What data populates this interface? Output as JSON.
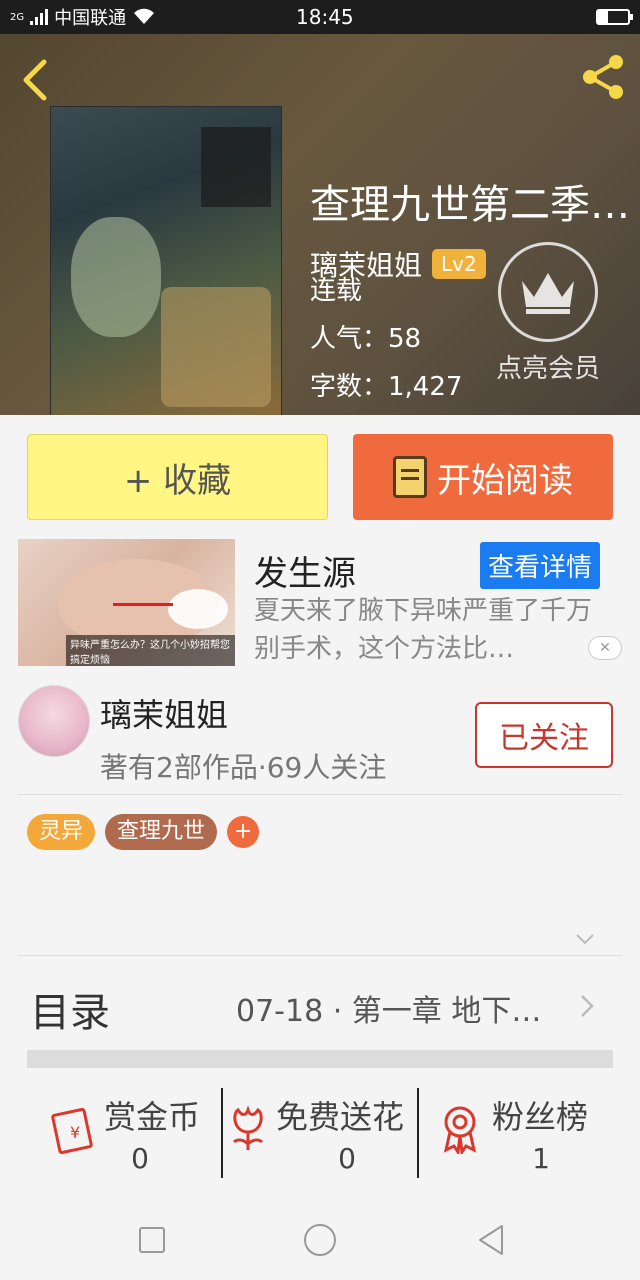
{
  "status_bar": {
    "network_type": "2G",
    "carrier": "中国联通",
    "time": "18:45"
  },
  "book": {
    "title": "查理九世第二季…",
    "author": "璃茉姐姐",
    "level": "Lv2",
    "status": "连载",
    "popularity": "人气：58",
    "word_count": "字数：1,427",
    "vip_label": "点亮会员"
  },
  "actions": {
    "collect_label": "+ 收藏",
    "read_label": "开始阅读"
  },
  "ad": {
    "title": "发生源",
    "detail_button": "查看详情",
    "description": "夏天来了腋下异味严重了千万别手术，这个方法比…",
    "image_caption": "异味严重怎么办？这几个小妙招帮您搞定烦恼"
  },
  "author_card": {
    "name": "璃茉姐姐",
    "stats": "著有2部作品·69人关注",
    "follow_label": "已关注"
  },
  "tags": [
    {
      "label": "灵异",
      "color": "#f4a83a"
    },
    {
      "label": "查理九世",
      "color": "#b06a4e"
    }
  ],
  "toc": {
    "label": "目录",
    "latest": "07-18 · 第一章  地下…"
  },
  "bottom_stats": [
    {
      "label": "赏金币",
      "value": "0",
      "icon": "red-envelope-icon"
    },
    {
      "label": "免费送花",
      "value": "0",
      "icon": "flower-icon"
    },
    {
      "label": "粉丝榜",
      "value": "1",
      "icon": "medal-icon"
    }
  ],
  "colors": {
    "accent_orange": "#ef6a3c",
    "collect_yellow": "#fff684",
    "follow_red": "#c8372d",
    "ad_blue": "#1a7cf0",
    "level_badge": "#f0b23b"
  }
}
